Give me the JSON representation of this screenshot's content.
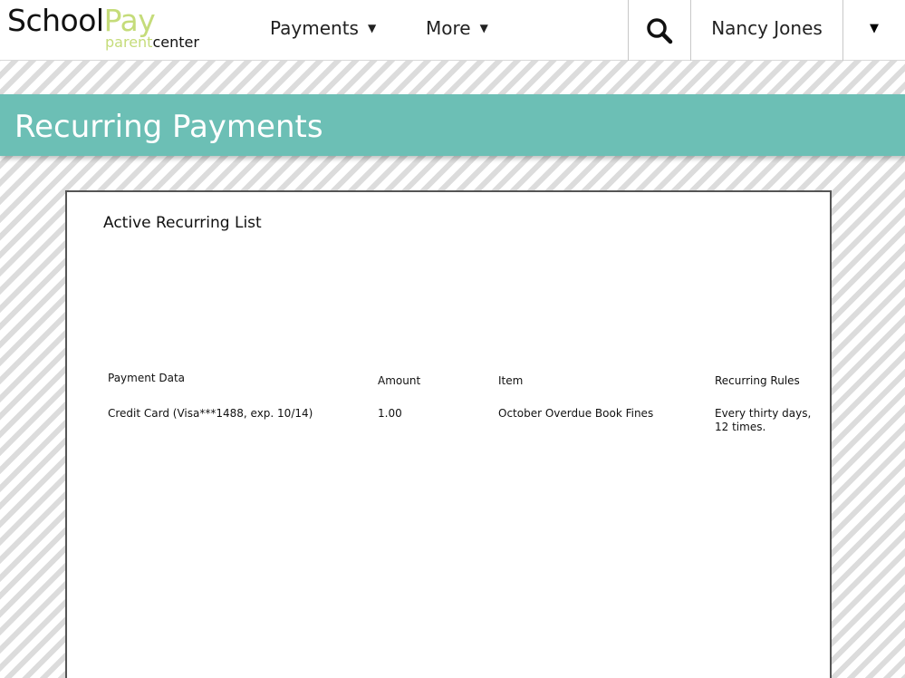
{
  "header": {
    "logo": {
      "school": "School",
      "pay": "Pay",
      "parent": "parent",
      "center": "center"
    },
    "nav": [
      {
        "label": "Payments"
      },
      {
        "label": "More"
      }
    ],
    "user_name": "Nancy Jones",
    "icons": {
      "search": "search-icon",
      "caret": "chevron-down-icon"
    }
  },
  "page": {
    "title": "Recurring Payments"
  },
  "panel": {
    "title": "Active Recurring List",
    "table": {
      "headers": [
        "Payment Data",
        "Amount",
        "Item",
        "Recurring Rules"
      ],
      "rows": [
        [
          "Credit Card (Visa***1488, exp. 10/14)",
          "1.00",
          "October Overdue Book Fines",
          "Every thirty days, 12 times."
        ]
      ]
    }
  },
  "colors": {
    "banner": "#6cbfb5",
    "logo_accent": "#c5dc7a"
  }
}
